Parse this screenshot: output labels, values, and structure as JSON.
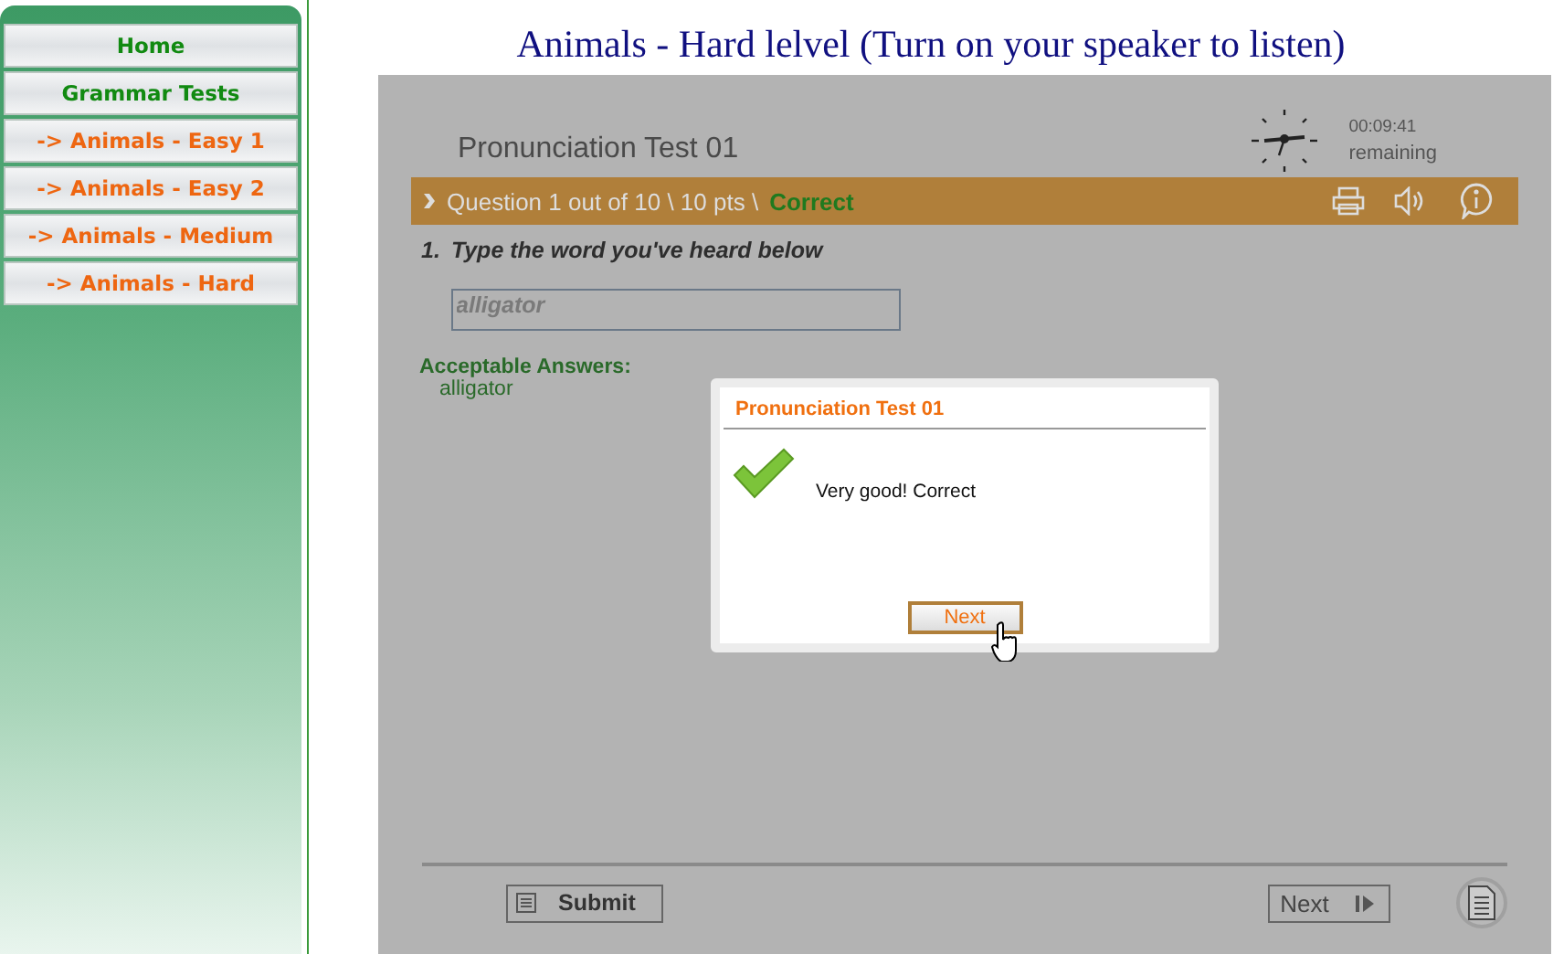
{
  "sidebar": {
    "items": [
      {
        "label": "Home",
        "kind": "section"
      },
      {
        "label": "Grammar Tests",
        "kind": "section"
      },
      {
        "label": "-> Animals - Easy 1",
        "kind": "link"
      },
      {
        "label": "-> Animals - Easy 2",
        "kind": "link"
      },
      {
        "label": "-> Animals - Medium",
        "kind": "link"
      },
      {
        "label": "-> Animals - Hard",
        "kind": "link"
      }
    ]
  },
  "page_title": "Animals - Hard lelvel (Turn on your speaker to listen)",
  "quiz": {
    "title": "Pronunciation Test 01",
    "timer": {
      "time": "00:09:41",
      "label": "remaining"
    },
    "question_bar": {
      "text": "Question 1 out of 10 \\ 10 pts \\",
      "result": "Correct"
    },
    "question": {
      "number": "1.",
      "text": "Type the word you've heard below"
    },
    "answer": {
      "value": "alligator"
    },
    "acceptable": {
      "label": "Acceptable Answers:",
      "value": "alligator"
    },
    "dialog": {
      "title": "Pronunciation Test 01",
      "message": "Very good! Correct",
      "button": "Next"
    },
    "footer": {
      "submit": "Submit",
      "next": "Next"
    }
  }
}
